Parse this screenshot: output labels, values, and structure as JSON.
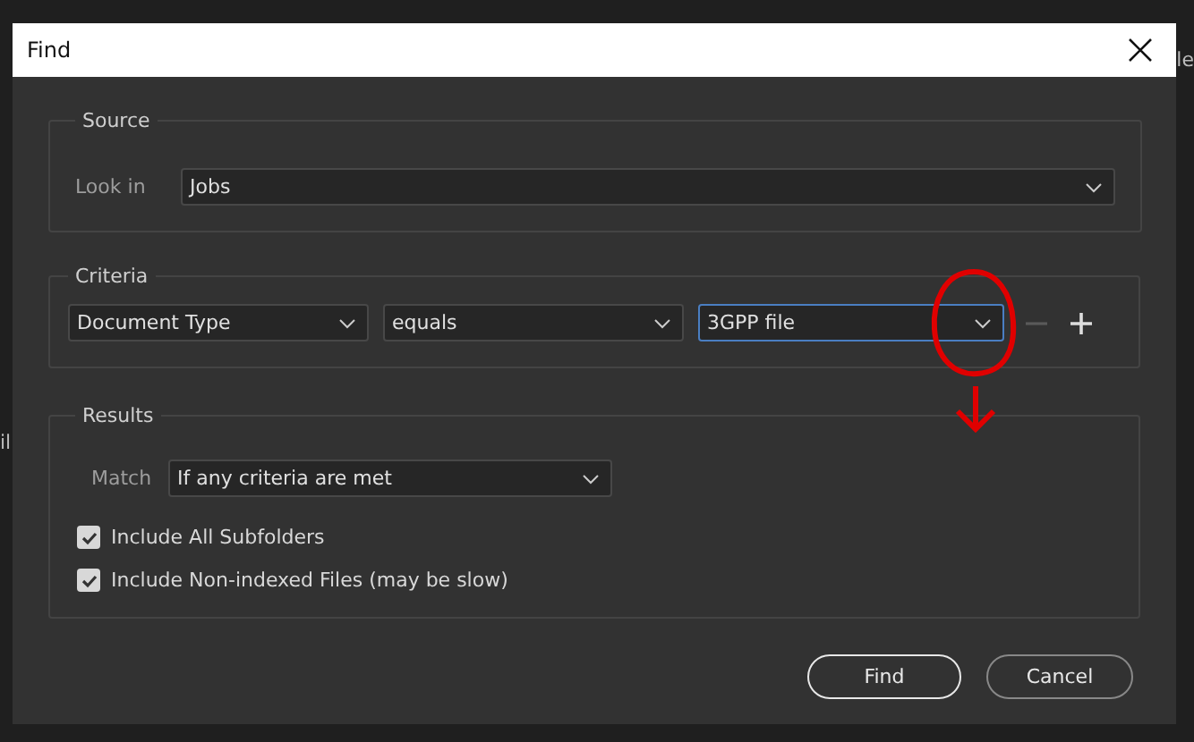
{
  "background_text": [
    {
      "text": "le"
    },
    {
      "text": "il"
    }
  ],
  "window": {
    "title": "Find"
  },
  "source": {
    "title": "Source",
    "look_in_label": "Look in",
    "look_in": "Jobs"
  },
  "criteria": {
    "title": "Criteria",
    "rows": [
      {
        "field": "Document Type",
        "operator": "equals",
        "value": "3GPP file",
        "focused": true
      }
    ],
    "remove_disabled": true
  },
  "results": {
    "title": "Results",
    "match_label": "Match",
    "match": "If any criteria are met",
    "options": [
      {
        "label": "Include All Subfolders",
        "checked": true
      },
      {
        "label": "Include Non-indexed Files (may be slow)",
        "checked": true
      }
    ]
  },
  "buttons": [
    {
      "label": "Find",
      "kind": "default"
    },
    {
      "label": "Cancel",
      "kind": "secondary"
    }
  ]
}
